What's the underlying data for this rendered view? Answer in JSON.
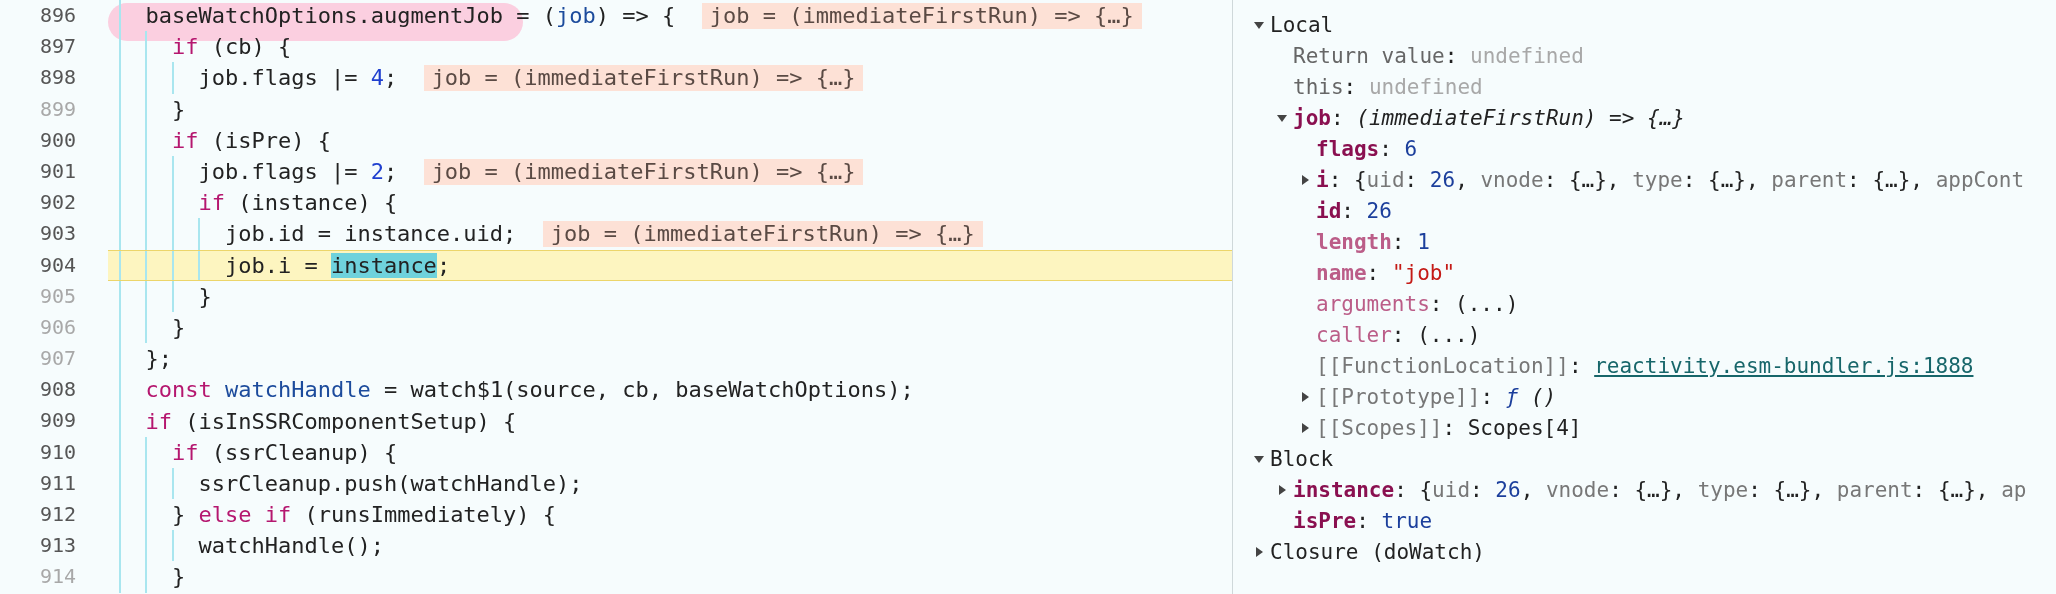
{
  "code_lines": [
    {
      "number": "896",
      "breakable": true,
      "current": false,
      "marked": true,
      "tokens": [
        {
          "text": "baseWatchOptions.augmentJob",
          "kind": "plain"
        },
        {
          "text": " = (",
          "kind": "plain"
        },
        {
          "text": "job",
          "kind": "def"
        },
        {
          "text": ") => {",
          "kind": "plain"
        }
      ],
      "inline_value": "job = (immediateFirstRun) => {…}",
      "children": [
        {
          "number": "897",
          "breakable": true,
          "current": false,
          "marked": false,
          "tokens": [
            {
              "text": "if",
              "kind": "keyword"
            },
            {
              "text": " (cb) {",
              "kind": "plain"
            }
          ],
          "children": [
            {
              "number": "898",
              "breakable": true,
              "current": false,
              "marked": false,
              "tokens": [
                {
                  "text": "job.flags |= ",
                  "kind": "plain"
                },
                {
                  "text": "4",
                  "kind": "number"
                },
                {
                  "text": ";",
                  "kind": "plain"
                }
              ],
              "inline_value": "job = (immediateFirstRun) => {…}"
            }
          ]
        },
        {
          "number": "899",
          "breakable": false,
          "current": false,
          "marked": false,
          "tokens": [
            {
              "text": "}",
              "kind": "plain"
            }
          ]
        },
        {
          "number": "900",
          "breakable": true,
          "current": false,
          "marked": false,
          "tokens": [
            {
              "text": "if",
              "kind": "keyword"
            },
            {
              "text": " (isPre) {",
              "kind": "plain"
            }
          ],
          "children": [
            {
              "number": "901",
              "breakable": true,
              "current": false,
              "marked": false,
              "tokens": [
                {
                  "text": "job.flags |= ",
                  "kind": "plain"
                },
                {
                  "text": "2",
                  "kind": "number"
                },
                {
                  "text": ";",
                  "kind": "plain"
                }
              ],
              "inline_value": "job = (immediateFirstRun) => {…}"
            },
            {
              "number": "902",
              "breakable": true,
              "current": false,
              "marked": false,
              "tokens": [
                {
                  "text": "if",
                  "kind": "keyword"
                },
                {
                  "text": " (instance) {",
                  "kind": "plain"
                }
              ],
              "children": [
                {
                  "number": "903",
                  "breakable": true,
                  "current": false,
                  "marked": false,
                  "tokens": [
                    {
                      "text": "job.id = instance.uid;",
                      "kind": "plain"
                    }
                  ],
                  "inline_value": "job = (immediateFirstRun) => {…}"
                },
                {
                  "number": "904",
                  "breakable": true,
                  "current": true,
                  "marked": false,
                  "tokens": [
                    {
                      "text": "job.i = ",
                      "kind": "plain"
                    },
                    {
                      "text": "instance",
                      "kind": "selection"
                    },
                    {
                      "text": ";",
                      "kind": "plain"
                    }
                  ]
                }
              ]
            },
            {
              "number": "905",
              "breakable": false,
              "current": false,
              "marked": false,
              "tokens": [
                {
                  "text": "}",
                  "kind": "plain"
                }
              ]
            }
          ]
        },
        {
          "number": "906",
          "breakable": false,
          "current": false,
          "marked": false,
          "tokens": [
            {
              "text": "}",
              "kind": "plain"
            }
          ]
        }
      ]
    },
    {
      "number": "907",
      "breakable": false,
      "current": false,
      "marked": false,
      "tokens": [
        {
          "text": "};",
          "kind": "plain"
        }
      ]
    },
    {
      "number": "908",
      "breakable": true,
      "current": false,
      "marked": false,
      "tokens": [
        {
          "text": "const ",
          "kind": "keyword"
        },
        {
          "text": "watchHandle",
          "kind": "def"
        },
        {
          "text": " = watch$1(source, cb, baseWatchOptions);",
          "kind": "plain"
        }
      ]
    },
    {
      "number": "909",
      "breakable": true,
      "current": false,
      "marked": false,
      "tokens": [
        {
          "text": "if",
          "kind": "keyword"
        },
        {
          "text": " (isInSSRComponentSetup) {",
          "kind": "plain"
        }
      ],
      "children": [
        {
          "number": "910",
          "breakable": true,
          "current": false,
          "marked": false,
          "tokens": [
            {
              "text": "if",
              "kind": "keyword"
            },
            {
              "text": " (ssrCleanup) {",
              "kind": "plain"
            }
          ],
          "children": [
            {
              "number": "911",
              "breakable": true,
              "current": false,
              "marked": false,
              "tokens": [
                {
                  "text": "ssrCleanup.push(watchHandle);",
                  "kind": "plain"
                }
              ]
            }
          ]
        },
        {
          "number": "912",
          "breakable": true,
          "current": false,
          "marked": false,
          "tokens": [
            {
              "text": "} ",
              "kind": "plain"
            },
            {
              "text": "else if",
              "kind": "keyword"
            },
            {
              "text": " (runsImmediately) {",
              "kind": "plain"
            }
          ],
          "children": [
            {
              "number": "913",
              "breakable": true,
              "current": false,
              "marked": false,
              "tokens": [
                {
                  "text": "watchHandle();",
                  "kind": "plain"
                }
              ]
            }
          ]
        },
        {
          "number": "914",
          "breakable": false,
          "current": false,
          "marked": false,
          "tokens": [
            {
              "text": "}",
              "kind": "plain"
            }
          ]
        }
      ]
    }
  ],
  "scope_panel": {
    "sections": [
      {
        "title": "Local",
        "expanded": true,
        "properties": [
          {
            "kind": "meta",
            "key": "Return value",
            "value": [
              {
                "text": ": ",
                "kind": "meta"
              },
              {
                "text": "undefined",
                "kind": "muted"
              }
            ]
          },
          {
            "kind": "meta",
            "key": "this",
            "value": [
              {
                "text": ": ",
                "kind": "meta"
              },
              {
                "text": "undefined",
                "kind": "muted"
              }
            ]
          },
          {
            "kind": "own",
            "expanded": true,
            "key": "job",
            "value": [
              {
                "text": ": ",
                "kind": "plain"
              },
              {
                "text": "(immediateFirstRun) => {…}",
                "kind": "italic"
              }
            ],
            "children": [
              {
                "kind": "own",
                "key": "flags",
                "value": [
                  {
                    "text": ": ",
                    "kind": "plain"
                  },
                  {
                    "text": "6",
                    "kind": "number"
                  }
                ]
              },
              {
                "kind": "own",
                "expanded": false,
                "key": "i",
                "value": [
                  {
                    "text": ": {",
                    "kind": "plain"
                  },
                  {
                    "text": "uid",
                    "kind": "preview_key"
                  },
                  {
                    "text": ": ",
                    "kind": "plain"
                  },
                  {
                    "text": "26",
                    "kind": "number"
                  },
                  {
                    "text": ", ",
                    "kind": "plain"
                  },
                  {
                    "text": "vnode",
                    "kind": "preview_key"
                  },
                  {
                    "text": ": {…}, ",
                    "kind": "plain"
                  },
                  {
                    "text": "type",
                    "kind": "preview_key"
                  },
                  {
                    "text": ": {…}, ",
                    "kind": "plain"
                  },
                  {
                    "text": "parent",
                    "kind": "preview_key"
                  },
                  {
                    "text": ": {…}, ",
                    "kind": "plain"
                  },
                  {
                    "text": "appCont",
                    "kind": "preview_key"
                  }
                ]
              },
              {
                "kind": "own",
                "key": "id",
                "value": [
                  {
                    "text": ": ",
                    "kind": "plain"
                  },
                  {
                    "text": "26",
                    "kind": "number"
                  }
                ]
              },
              {
                "kind": "nonenum",
                "key": "length",
                "value": [
                  {
                    "text": ": ",
                    "kind": "plain"
                  },
                  {
                    "text": "1",
                    "kind": "number"
                  }
                ]
              },
              {
                "kind": "nonenum",
                "key": "name",
                "value": [
                  {
                    "text": ": ",
                    "kind": "plain"
                  },
                  {
                    "text": "\"job\"",
                    "kind": "string"
                  }
                ]
              },
              {
                "kind": "accessor",
                "key": "arguments",
                "value": [
                  {
                    "text": ": (...)",
                    "kind": "plain"
                  }
                ]
              },
              {
                "kind": "accessor",
                "key": "caller",
                "value": [
                  {
                    "text": ": (...)",
                    "kind": "plain"
                  }
                ]
              },
              {
                "kind": "internal",
                "key": "[[FunctionLocation]]",
                "value": [
                  {
                    "text": ": ",
                    "kind": "plain"
                  }
                ],
                "link": "reactivity.esm-bundler.js:1888"
              },
              {
                "kind": "internal",
                "expanded": false,
                "key": "[[Prototype]]",
                "value": [
                  {
                    "text": ": ",
                    "kind": "plain"
                  },
                  {
                    "text": "ƒ",
                    "kind": "function"
                  },
                  {
                    "text": " ()",
                    "kind": "italic"
                  }
                ]
              },
              {
                "kind": "internal",
                "expanded": false,
                "key": "[[Scopes]]",
                "value": [
                  {
                    "text": ": Scopes[4]",
                    "kind": "plain"
                  }
                ]
              }
            ]
          }
        ]
      },
      {
        "title": "Block",
        "expanded": true,
        "properties": [
          {
            "kind": "own",
            "expanded": false,
            "key": "instance",
            "value": [
              {
                "text": ": {",
                "kind": "plain"
              },
              {
                "text": "uid",
                "kind": "preview_key"
              },
              {
                "text": ": ",
                "kind": "plain"
              },
              {
                "text": "26",
                "kind": "number"
              },
              {
                "text": ", ",
                "kind": "plain"
              },
              {
                "text": "vnode",
                "kind": "preview_key"
              },
              {
                "text": ": {…}, ",
                "kind": "plain"
              },
              {
                "text": "type",
                "kind": "preview_key"
              },
              {
                "text": ": {…}, ",
                "kind": "plain"
              },
              {
                "text": "parent",
                "kind": "preview_key"
              },
              {
                "text": ": {…}, ",
                "kind": "plain"
              },
              {
                "text": "ap",
                "kind": "preview_key"
              }
            ]
          },
          {
            "kind": "own",
            "key": "isPre",
            "value": [
              {
                "text": ": ",
                "kind": "plain"
              },
              {
                "text": "true",
                "kind": "number"
              }
            ]
          }
        ]
      },
      {
        "title": "Closure (doWatch)",
        "expanded": false
      }
    ]
  }
}
